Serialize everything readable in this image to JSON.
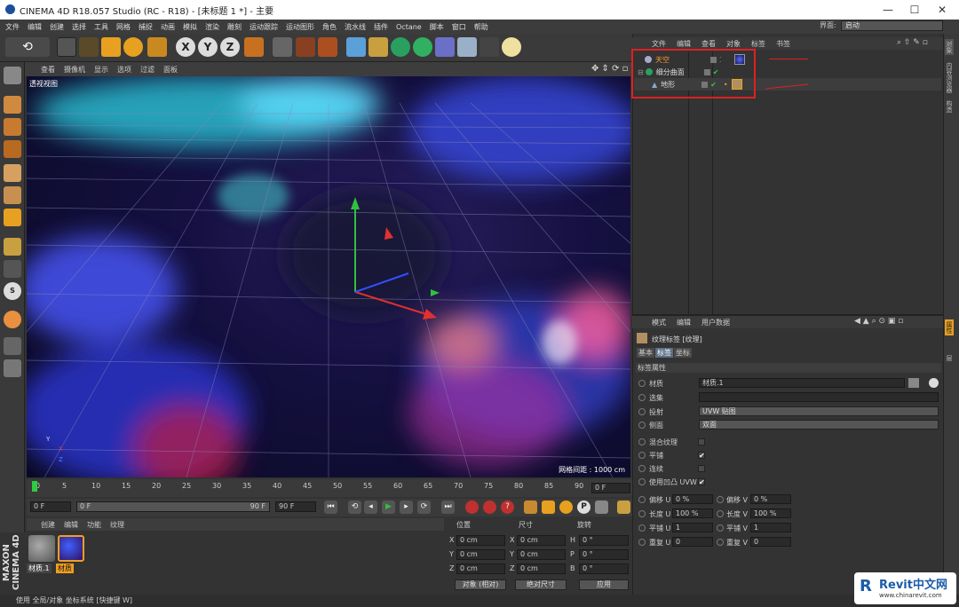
{
  "title": "CINEMA 4D R18.057 Studio (RC - R18) - [未标题 1 *] - 主要",
  "window_controls": [
    "—",
    "☐",
    "✕"
  ],
  "menu": [
    "文件",
    "编辑",
    "创建",
    "选择",
    "工具",
    "网格",
    "捕捉",
    "动画",
    "模拟",
    "渲染",
    "雕刻",
    "运动跟踪",
    "运动图形",
    "角色",
    "流水线",
    "插件",
    "Octane",
    "脚本",
    "窗口",
    "帮助"
  ],
  "layout_label": "界面:",
  "layout_value": "启动",
  "viewport": {
    "menu": [
      "查看",
      "摄像机",
      "显示",
      "选项",
      "过滤",
      "面板"
    ],
    "label": "透视视图",
    "grid_label": "网格间距 : 1000 cm",
    "axis": {
      "y": "Y",
      "x": "X",
      "z": "Z"
    }
  },
  "timeline": {
    "ticks": [
      "0",
      "5",
      "10",
      "15",
      "20",
      "25",
      "30",
      "35",
      "40",
      "45",
      "50",
      "55",
      "60",
      "65",
      "70",
      "75",
      "80",
      "85",
      "90"
    ],
    "current_frame": "0 F"
  },
  "playbar": {
    "start": "0 F",
    "slider_start": "0 F",
    "slider_end": "90 F",
    "end": "90 F"
  },
  "materials": {
    "tabs": [
      "创建",
      "编辑",
      "功能",
      "纹理"
    ],
    "items": [
      "材质.1",
      "材质"
    ]
  },
  "coords": {
    "headers": [
      "位置",
      "尺寸",
      "旋转"
    ],
    "pos_labels": [
      "X",
      "Y",
      "Z"
    ],
    "pos": [
      "0 cm",
      "0 cm",
      "0 cm"
    ],
    "size": [
      "0 cm",
      "0 cm",
      "0 cm"
    ],
    "rot_labels": [
      "H",
      "P",
      "B"
    ],
    "rot": [
      "0 °",
      "0 °",
      "0 °"
    ],
    "mode": "对象 (相对)",
    "size_mode": "绝对尺寸",
    "apply": "应用"
  },
  "object_manager": {
    "menu": [
      "文件",
      "编辑",
      "查看",
      "对象",
      "标签",
      "书签"
    ],
    "objects": [
      {
        "name": "天空",
        "color": "#ff9a2e"
      },
      {
        "name": "细分曲面",
        "color": "#dddddd"
      },
      {
        "name": "地形",
        "color": "#dddddd"
      }
    ]
  },
  "attribute_manager": {
    "menu": [
      "模式",
      "编辑",
      "用户数据"
    ],
    "title": "纹理标签 [纹理]",
    "tabs": [
      "基本",
      "标签",
      "坐标"
    ],
    "active_tab": "标签",
    "section": "标签属性",
    "fields": {
      "material_label": "材质",
      "material_value": "材质.1",
      "selection_label": "选集",
      "projection_label": "投射",
      "projection_value": "UVW 贴图",
      "side_label": "侧面",
      "side_value": "双面",
      "mix_label": "混合纹理",
      "tile_label": "平铺",
      "seamless_label": "连续",
      "bump_label": "使用凹凸 UVW"
    },
    "params": [
      {
        "l1": "偏移 U",
        "v1": "0 %",
        "l2": "偏移 V",
        "v2": "0 %"
      },
      {
        "l1": "长度 U",
        "v1": "100 %",
        "l2": "长度 V",
        "v2": "100 %"
      },
      {
        "l1": "平铺 U",
        "v1": "1",
        "l2": "平铺 V",
        "v2": "1"
      },
      {
        "l1": "重复 U",
        "v1": "0",
        "l2": "重复 V",
        "v2": "0"
      }
    ]
  },
  "right_tabs": [
    "对象",
    "内容浏览器",
    "构造",
    "属性",
    "层"
  ],
  "status": "使用 全局/对象 坐标系统 [快捷键 W]",
  "maxon": "MAXON CINEMA 4D",
  "watermark": {
    "brand": "Revit中文网",
    "url": "www.chinarevit.com"
  }
}
